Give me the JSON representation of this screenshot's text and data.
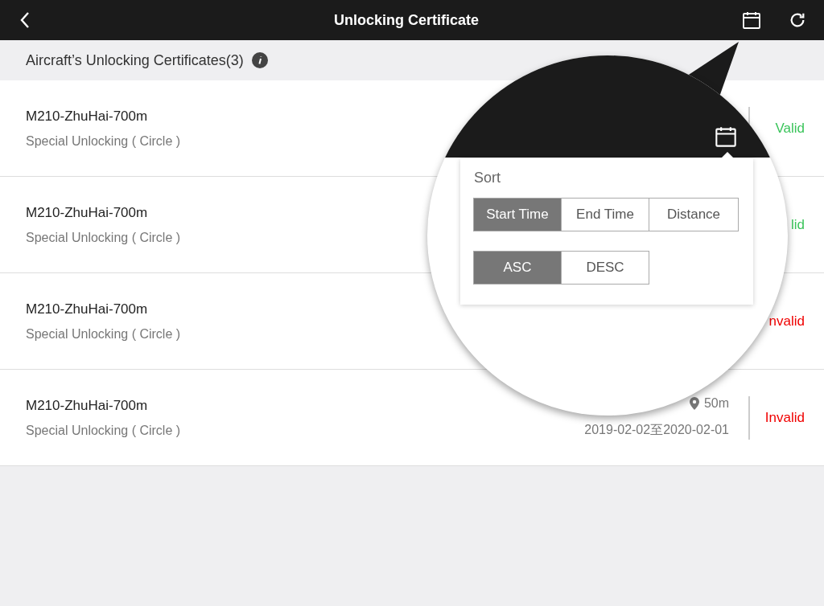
{
  "header": {
    "title": "Unlocking Certificate"
  },
  "list_title": "Aircraft’s Unlocking Certificates(3)",
  "certificates": [
    {
      "name": "M210-ZhuHai-700m",
      "type": "Special Unlocking ( Circle )",
      "status": "Valid",
      "valid": true
    },
    {
      "name": "M210-ZhuHai-700m",
      "type": "Special Unlocking ( Circle )",
      "status": "lid",
      "valid": true
    },
    {
      "name": "M210-ZhuHai-700m",
      "type": "Special Unlocking ( Circle )",
      "status": "nvalid",
      "valid": false
    },
    {
      "name": "M210-ZhuHai-700m",
      "type": "Special Unlocking ( Circle )",
      "distance": "50m",
      "dates": "2019-02-02至2020-02-01",
      "status": "Invalid",
      "valid": false
    }
  ],
  "sort_popup": {
    "title": "Sort",
    "fields": [
      {
        "label": "Start Time",
        "selected": true
      },
      {
        "label": "End Time",
        "selected": false
      },
      {
        "label": "Distance",
        "selected": false
      }
    ],
    "orders": [
      {
        "label": "ASC",
        "selected": true
      },
      {
        "label": "DESC",
        "selected": false
      }
    ]
  }
}
